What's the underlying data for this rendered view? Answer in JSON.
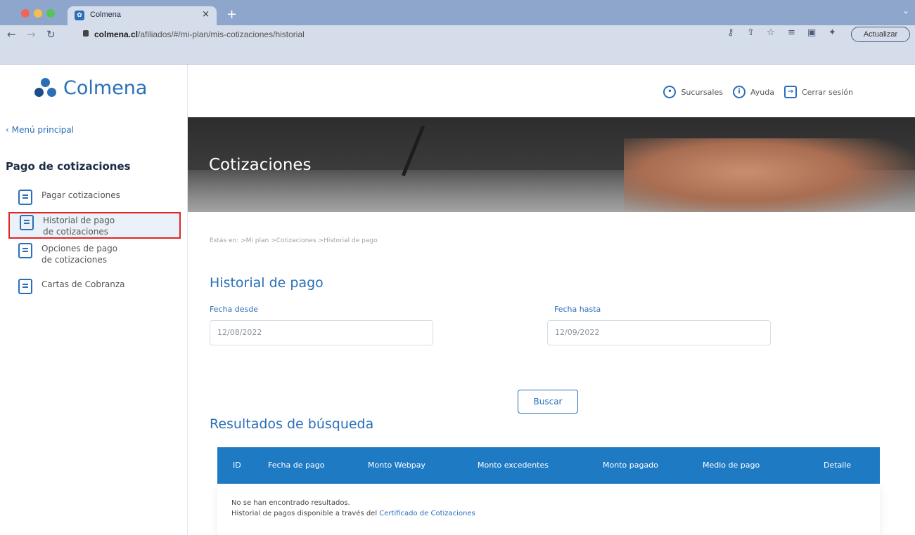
{
  "browser": {
    "tab_title": "Colmena",
    "url_domain": "colmena.cl",
    "url_path": "/afiliados/#/mi-plan/mis-cotizaciones/historial",
    "update_label": "Actualizar"
  },
  "header": {
    "logo_text": "Colmena",
    "links": [
      {
        "label": "Sucursales",
        "icon": "location-pin-icon"
      },
      {
        "label": "Ayuda",
        "icon": "info-icon"
      },
      {
        "label": "Cerrar sesión",
        "icon": "logout-icon"
      }
    ]
  },
  "sidebar": {
    "back_label": "Menú principal",
    "section_title": "Pago de cotizaciones",
    "items": [
      {
        "label": "Pagar cotizaciones",
        "icon": "document-icon"
      },
      {
        "label": "Historial de pago de cotizaciones",
        "icon": "history-document-icon",
        "active": true
      },
      {
        "label": "Opciones de pago de cotizaciones",
        "icon": "payment-options-icon"
      },
      {
        "label": "Cartas de Cobranza",
        "icon": "letter-icon"
      }
    ]
  },
  "hero": {
    "title": "Cotizaciones"
  },
  "main": {
    "breadcrumb": "Estás en: >Mi plan >Cotizaciones >Historial de pago",
    "heading": "Historial de pago",
    "date_from_label": "Fecha desde",
    "date_from_value": "12/08/2022",
    "date_to_label": "Fecha hasta",
    "date_to_value": "12/09/2022",
    "search_label": "Buscar",
    "results_heading": "Resultados de búsqueda",
    "table": {
      "columns": [
        "ID",
        "Fecha de pago",
        "Monto Webpay",
        "Monto excedentes",
        "Monto pagado",
        "Medio de pago",
        "Detalle"
      ],
      "empty_message": "No se han encontrado resultados.",
      "empty_note_prefix": "Historial de pagos disponible a través del ",
      "empty_note_link": "Certificado de Cotizaciones"
    }
  }
}
